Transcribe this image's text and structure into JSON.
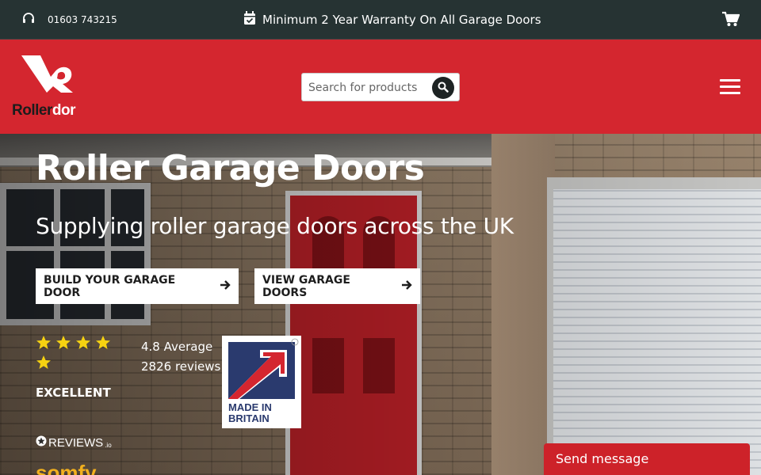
{
  "topbar": {
    "phone": "01603 743215",
    "warranty": "Minimum 2 Year Warranty On All Garage Doors",
    "icons": [
      "headset-icon",
      "calendar-check-icon",
      "cart-icon"
    ]
  },
  "header": {
    "logo_word_a": "Roller",
    "logo_word_b": "dor",
    "search_placeholder": "Search for products",
    "brand_color": "#d4262f"
  },
  "hero": {
    "title": "Roller Garage Doors",
    "subtitle": "Supplying roller garage doors across the UK",
    "cta_primary": "BUILD YOUR GARAGE DOOR",
    "cta_secondary": "VIEW GARAGE DOORS",
    "rating_average": "4.8 Average",
    "review_count": "2826 reviews",
    "rating_word": "EXCELLENT",
    "stars": 5,
    "reviews_brand": "REVIEWS",
    "reviews_brand_suffix": ".io",
    "badge_line1": "MADE IN",
    "badge_line2": "BRITAIN",
    "partner_logo": "somfy"
  },
  "chat": {
    "label": "Send message"
  }
}
